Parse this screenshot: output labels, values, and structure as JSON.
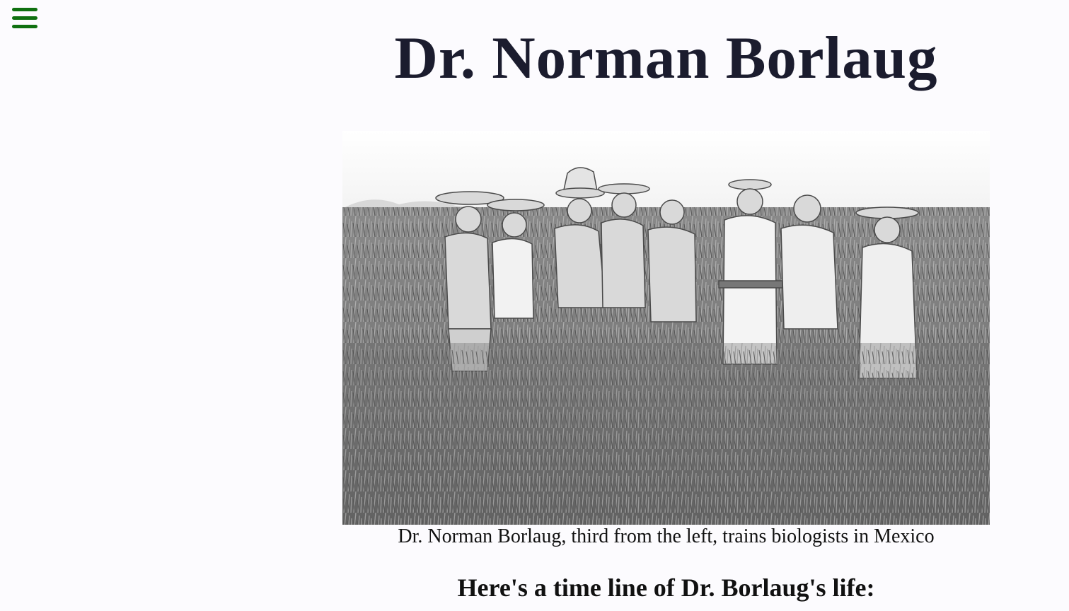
{
  "nav": {
    "menu_icon": "hamburger-menu-icon",
    "accent_color": "#0f7010"
  },
  "header": {
    "title": "Dr. Norman Borlaug"
  },
  "figure": {
    "image_subject": "black-and-white photo of men in a wheat field",
    "caption": "Dr. Norman Borlaug, third from the left, trains biologists in Mexico"
  },
  "timeline": {
    "heading": "Here's a time line of Dr. Borlaug's life:"
  },
  "colors": {
    "background": "#fcfbfe",
    "title": "#1b1c2e"
  }
}
